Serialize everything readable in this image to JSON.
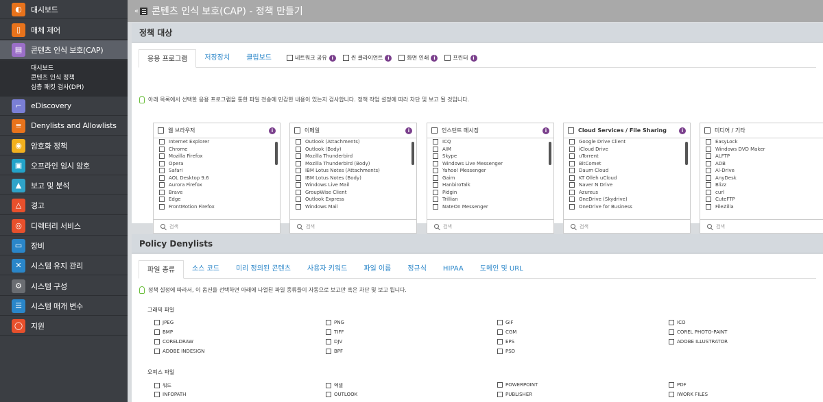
{
  "sidebar": {
    "items": [
      {
        "label": "대시보드",
        "icon": "dashboard-icon",
        "color": "#e8731c"
      },
      {
        "label": "매체 제어",
        "icon": "usb-device-icon",
        "color": "#e8731c"
      },
      {
        "label": "콘텐츠 인식 보호(CAP)",
        "icon": "document-protect-icon",
        "color": "#9b6fc8"
      },
      {
        "label": "eDiscovery",
        "icon": "telescope-icon",
        "color": "#7a7fd6"
      },
      {
        "label": "Denylists and Allowlists",
        "icon": "list-icon",
        "color": "#e8731c"
      },
      {
        "label": "암호화 정책",
        "icon": "encryption-icon",
        "color": "#f2b01e"
      },
      {
        "label": "오프라인 임시 암호",
        "icon": "offline-password-icon",
        "color": "#23a3c9"
      },
      {
        "label": "보고 및 분석",
        "icon": "chart-icon",
        "color": "#2fa3c9"
      },
      {
        "label": "경고",
        "icon": "warning-icon",
        "color": "#e8502c"
      },
      {
        "label": "디렉터리 서비스",
        "icon": "directory-icon",
        "color": "#e8502c"
      },
      {
        "label": "장비",
        "icon": "computer-icon",
        "color": "#2a86c9"
      },
      {
        "label": "시스템 유지 관리",
        "icon": "tools-icon",
        "color": "#2a86c9"
      },
      {
        "label": "시스템 구성",
        "icon": "gear-icon",
        "color": "#6a6d72"
      },
      {
        "label": "시스템 매개 변수",
        "icon": "parameters-icon",
        "color": "#2a86c9"
      },
      {
        "label": "지원",
        "icon": "support-icon",
        "color": "#e8502c"
      }
    ],
    "subitems": [
      "대시보드",
      "콘텐츠 인식 정책",
      "심층 패킷 검사(DPI)"
    ]
  },
  "header": {
    "title": "콘텐츠 인식 보호(CAP) - 정책 만들기"
  },
  "policy_target": {
    "heading": "정책 대상",
    "tabs": [
      "응용 프로그램",
      "저장장치",
      "클립보드"
    ],
    "options": [
      "네트워크 공유",
      "씬 클라이언트",
      "화면 인쇄",
      "프린터"
    ],
    "hint": "아래 목록에서 선택한 응용 프로그램을 통한 파일 전송에 민감한 내용이 있는지 검사합니다. 정책 작업 설정에 따라 차단 및 보고 될 것입니다.",
    "search_placeholder": "검색",
    "boxes": [
      {
        "title": "웹 브라우저",
        "items": [
          "Internet Explorer",
          "Chrome",
          "Mozilla Firefox",
          "Opera",
          "Safari",
          "AOL Desktop 9.6",
          "Aurora Firefox",
          "Brave",
          "Edge",
          "FrontMotion Firefox"
        ]
      },
      {
        "title": "이메일",
        "items": [
          "Outlook (Attachments)",
          "Outlook (Body)",
          "Mozilla Thunderbird",
          "Mozilla Thunderbird (Body)",
          "IBM Lotus Notes (Attachments)",
          "IBM Lotus Notes (Body)",
          "Windows Live Mail",
          "GroupWise Client",
          "Outlook Express",
          "Windows Mail"
        ]
      },
      {
        "title": "인스턴트 메시징",
        "items": [
          "ICQ",
          "AIM",
          "Skype",
          "Windows Live Messenger",
          "Yahoo! Messenger",
          "Gaim",
          "HanbiroTalk",
          "Pidgin",
          "Trillian",
          "NateOn Messenger"
        ]
      },
      {
        "title": "Cloud Services / File Sharing",
        "items": [
          "Google Drive Client",
          "iCloud Drive",
          "uTorrent",
          "BitComet",
          "Daum Cloud",
          "KT Olleh uCloud",
          "Naver N Drive",
          "Azureus",
          "OneDrive (Skydrive)",
          "OneDrive for Business"
        ]
      },
      {
        "title": "미디어 / 기타",
        "items": [
          "EasyLock",
          "Windows DVD Maker",
          "ALFTP",
          "ADB",
          "Al-Drive",
          "AnyDesk",
          "Blizz",
          "curl",
          "CuteFTP",
          "FileZilla"
        ]
      }
    ]
  },
  "denylists": {
    "heading": "Policy Denylists",
    "tabs": [
      "파일 종류",
      "소스 코드",
      "미리 정의된 콘텐츠",
      "사용자 키워드",
      "파일 이름",
      "정규식",
      "HIPAA",
      "도메인 및 URL"
    ],
    "hint": "정책 설정에 따라서, 이 옵션을 선택하면 아래에 나열된 파일 종류들이 자동으로 보고만 혹은 차단 및 보고 됩니다.",
    "sections": [
      {
        "title": "그래픽 파일",
        "rows": [
          [
            "JPEG",
            "PNG",
            "GIF",
            "ICO"
          ],
          [
            "BMP",
            "TIFF",
            "CGM",
            "COREL PHOTO-PAINT"
          ],
          [
            "CORELDRAW",
            "DJV",
            "EPS",
            "ADOBE ILLUSTRATOR"
          ],
          [
            "ADOBE INDESIGN",
            "BPF",
            "PSD",
            ""
          ]
        ]
      },
      {
        "title": "오피스 파일",
        "rows": [
          [
            "워드",
            "엑셀",
            "POWERPOINT",
            "PDF"
          ],
          [
            "INFOPATH",
            "OUTLOOK",
            "PUBLISHER",
            "IWORK FILES"
          ]
        ]
      }
    ]
  }
}
